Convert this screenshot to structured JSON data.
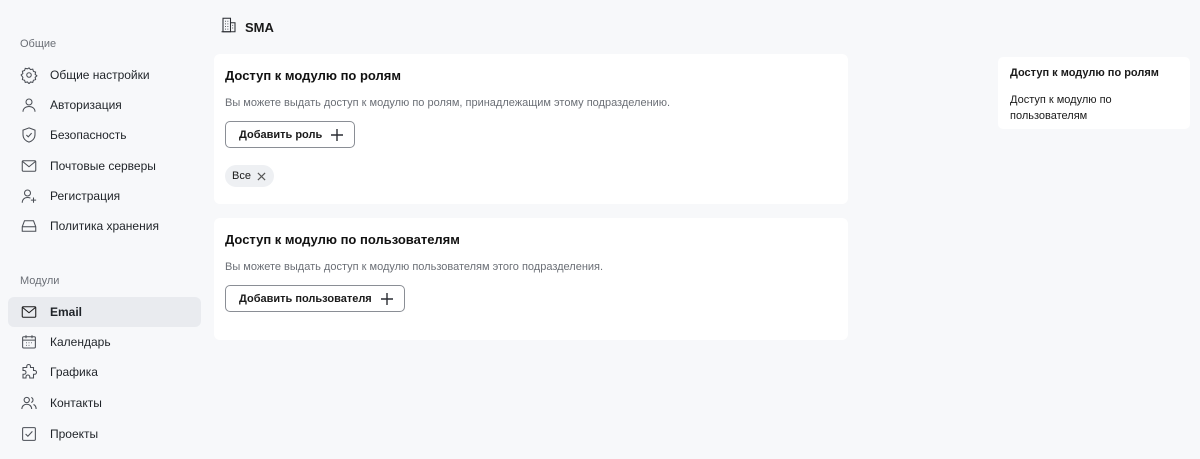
{
  "sidebar": {
    "general_label": "Общие",
    "modules_label": "Модули",
    "general_items": [
      {
        "label": "Общие настройки",
        "icon": "gear-icon"
      },
      {
        "label": "Авторизация",
        "icon": "user-icon"
      },
      {
        "label": "Безопасность",
        "icon": "shield-check-icon"
      },
      {
        "label": "Почтовые серверы",
        "icon": "envelope-icon"
      },
      {
        "label": "Регистрация",
        "icon": "user-plus-icon"
      },
      {
        "label": "Политика хранения",
        "icon": "storage-icon"
      }
    ],
    "module_items": [
      {
        "label": "Email",
        "icon": "envelope-icon",
        "active": true
      },
      {
        "label": "Календарь",
        "icon": "calendar-icon"
      },
      {
        "label": "Графика",
        "icon": "puzzle-icon"
      },
      {
        "label": "Контакты",
        "icon": "users-icon"
      },
      {
        "label": "Проекты",
        "icon": "checkbox-icon"
      }
    ]
  },
  "header": {
    "title": "SMA",
    "icon": "building-icon"
  },
  "roles_card": {
    "title": "Доступ к модулю по ролям",
    "description": "Вы можете выдать доступ к модулю по ролям, принадлежащим этому подразделению.",
    "add_button": "Добавить роль",
    "chips": [
      "Все"
    ]
  },
  "users_card": {
    "title": "Доступ к модулю по пользователям",
    "description": "Вы можете выдать доступ к модулю пользователям этого подразделения.",
    "add_button": "Добавить пользователя"
  },
  "anchors": {
    "items": [
      {
        "label": "Доступ к модулю по ролям",
        "active": true
      },
      {
        "label": "Доступ к модулю по пользователям",
        "active": false
      }
    ]
  }
}
